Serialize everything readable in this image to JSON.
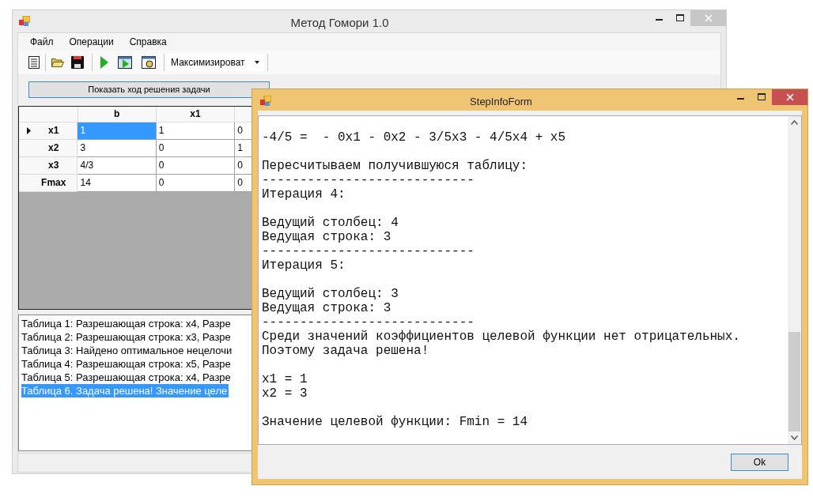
{
  "main_window": {
    "title": "Метод Гомори 1.0",
    "menu": [
      "Файл",
      "Операции",
      "Справка"
    ],
    "toolbar": {
      "mode_select": "Максимизироват"
    },
    "show_steps_button": "Показать ход решения задачи",
    "grid": {
      "columns": [
        "b",
        "x1"
      ],
      "rows": [
        {
          "header": "x1",
          "current": true,
          "cells": [
            {
              "text": "1",
              "selected": true
            },
            {
              "text": "1",
              "selected": false
            },
            {
              "text": "0",
              "selected": false
            }
          ]
        },
        {
          "header": "x2",
          "current": false,
          "cells": [
            {
              "text": "3",
              "selected": false
            },
            {
              "text": "0",
              "selected": false
            },
            {
              "text": "1",
              "selected": false
            }
          ]
        },
        {
          "header": "x3",
          "current": false,
          "cells": [
            {
              "text": "4/3",
              "selected": false
            },
            {
              "text": "0",
              "selected": false
            },
            {
              "text": "0",
              "selected": false
            }
          ]
        },
        {
          "header": "Fmax",
          "current": false,
          "cells": [
            {
              "text": "14",
              "selected": false
            },
            {
              "text": "0",
              "selected": false
            },
            {
              "text": "0",
              "selected": false
            }
          ]
        }
      ]
    },
    "log": [
      {
        "text": "Таблица 1: Разрешающая строка: x4, Разре",
        "selected": false
      },
      {
        "text": "Таблица 2: Разрешающая строка: x3, Разре",
        "selected": false
      },
      {
        "text": "Таблица 3: Найдено оптимальное нецелочи",
        "selected": false
      },
      {
        "text": "Таблица 4: Разрешающая строка: x5, Разре",
        "selected": false
      },
      {
        "text": "Таблица 5: Разрешающая строка: x4, Разре",
        "selected": false
      },
      {
        "text": "Таблица 6. Задача решена! Значение целе",
        "selected": true
      }
    ]
  },
  "step_dialog": {
    "title": "StepInfoForm",
    "blocks": [
      [
        "-4/5 =  - 0x1 - 0x2 - 3/5x3 - 4/5x4 + x5"
      ],
      [
        "Пересчитываем получившуюся таблицу:",
        "----------------------------",
        "Итерация 4:"
      ],
      [
        "Ведущий столбец: 4",
        "Ведущая строка: 3",
        "----------------------------",
        "Итерация 5:"
      ],
      [
        "Ведущий столбец: 3",
        "Ведущая строка: 3",
        "----------------------------",
        "Среди значений коэффициентов целевой функции нет отрицательных.",
        "Поэтому задача решена!"
      ],
      [
        "x1 = 1",
        "x2 = 3"
      ],
      [
        "Значение целевой функции: Fmin = 14"
      ]
    ],
    "ok_button": "Ok"
  }
}
